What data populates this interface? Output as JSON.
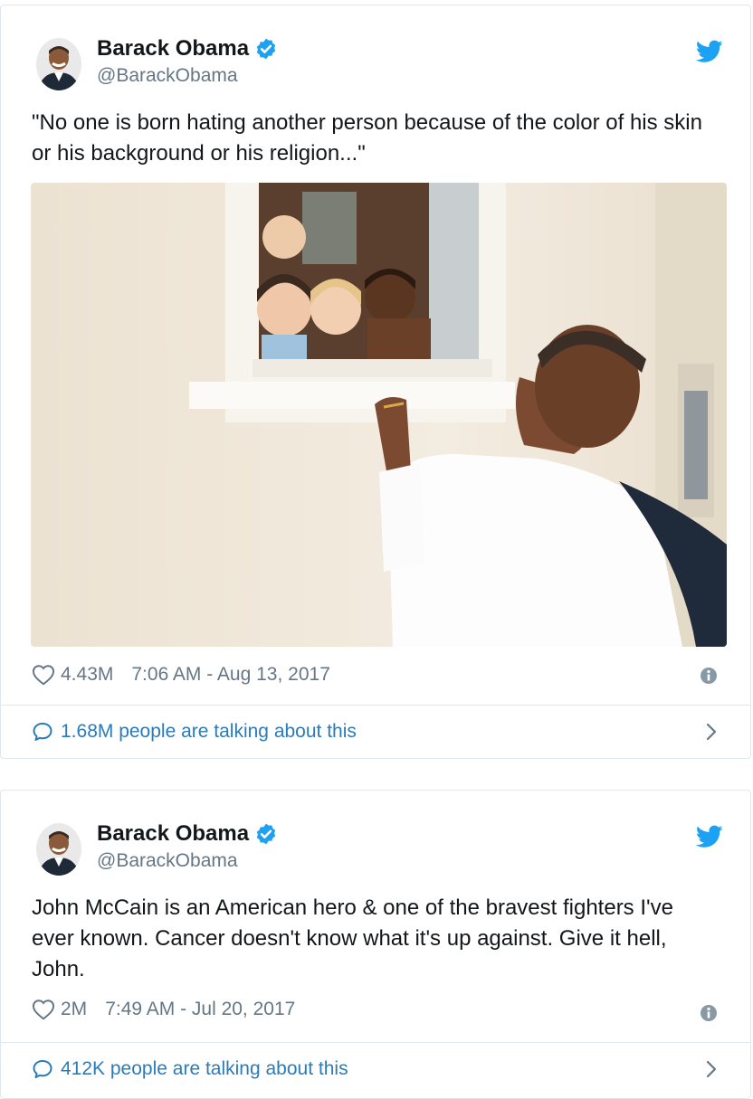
{
  "tweets": [
    {
      "author_name": "Barack Obama",
      "handle": "@BarackObama",
      "text": "\"No one is born hating another person because of the color of his skin or his background or his religion...\"",
      "likes": "4.43M",
      "timestamp": "7:06 AM - Aug 13, 2017",
      "talking": "1.68M people are talking about this",
      "icons": {
        "verified": "verified-badge-icon",
        "bird": "twitter-bird-icon",
        "heart": "heart-icon",
        "info": "info-icon",
        "bubble": "speech-bubble-icon",
        "chevron": "chevron-right-icon"
      }
    },
    {
      "author_name": "Barack Obama",
      "handle": "@BarackObama",
      "text": "John McCain is an American hero & one of the bravest fighters I've ever known. Cancer doesn't know what it's up against. Give it hell, John.",
      "likes": "2M",
      "timestamp": "7:49 AM - Jul 20, 2017",
      "talking": "412K people are talking about this"
    }
  ],
  "colors": {
    "twitter_blue": "#1da1f2",
    "link_blue": "#2b7bb9",
    "muted_text": "#657786",
    "border": "#e1e8ed"
  }
}
